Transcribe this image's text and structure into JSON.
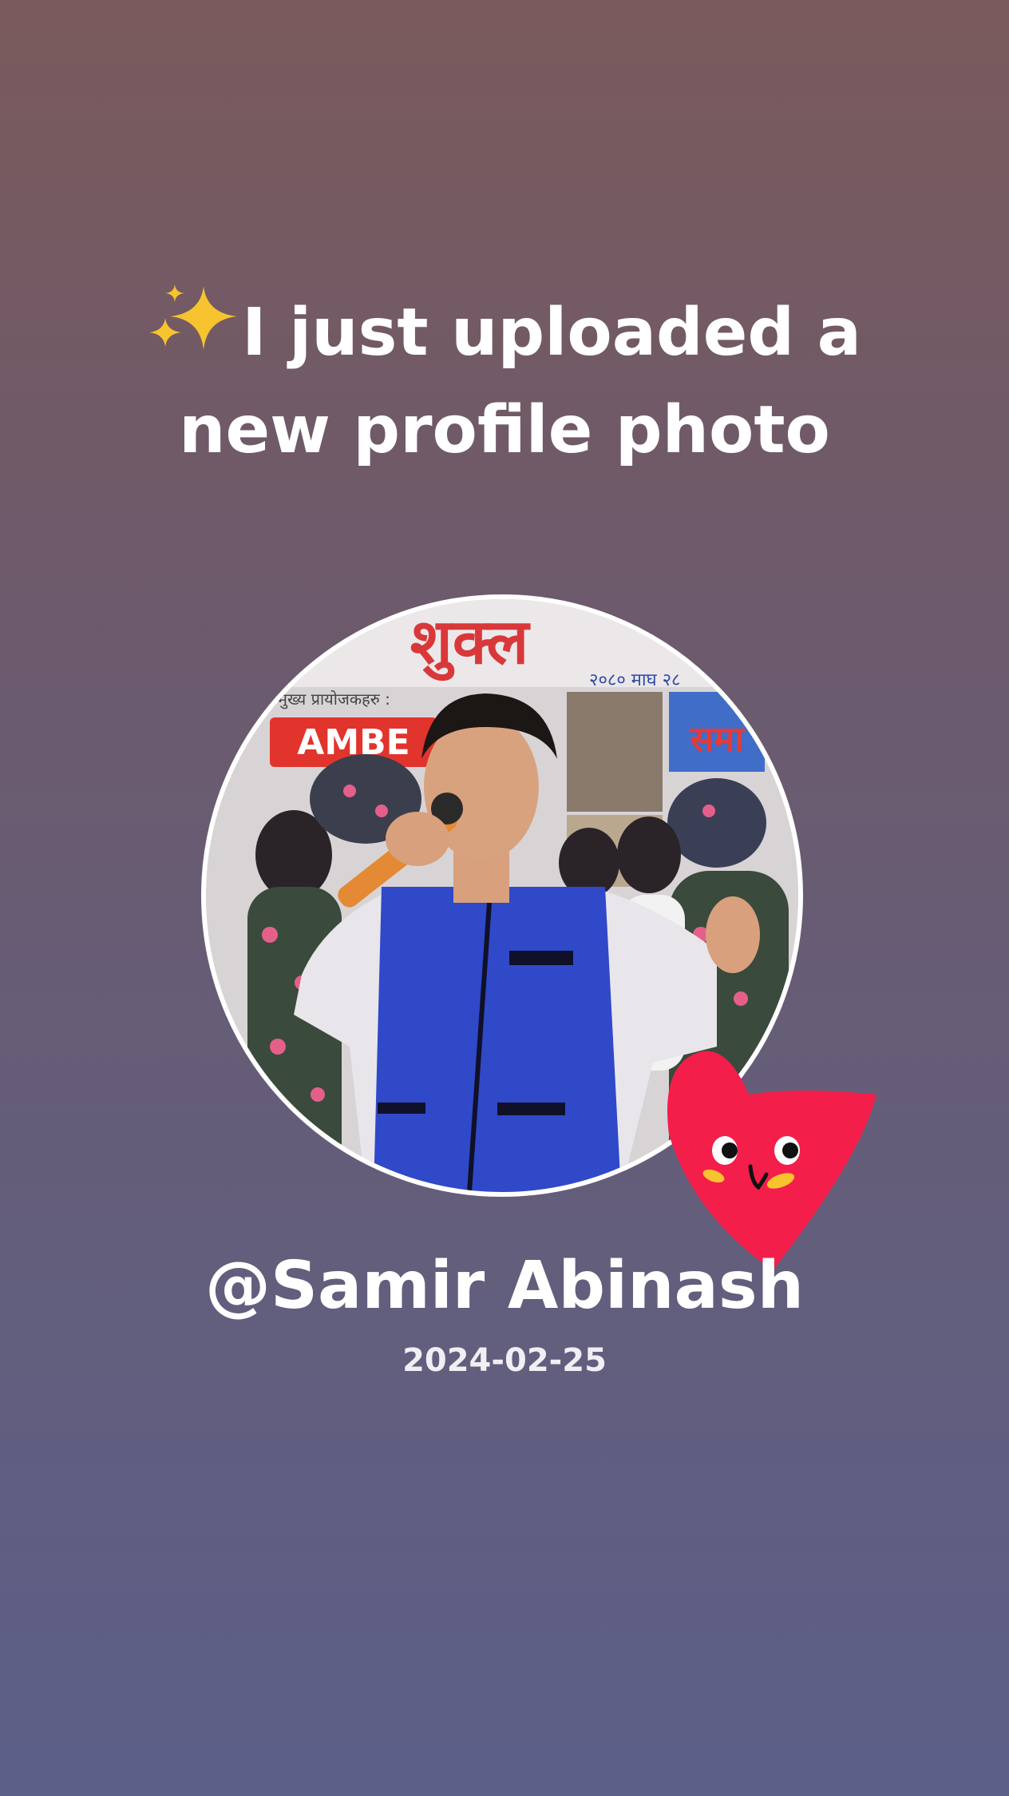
{
  "post": {
    "headline_line1": "I just uploaded a",
    "headline_line2": "new profile photo",
    "headline_icon": "sparkles-icon",
    "username": "@Samir Abinash",
    "date": "2024-02-25"
  },
  "photo": {
    "description_icon": "profile-photo",
    "banner_text": "शुक्ल",
    "banner_subtext": "२०८० माघ २८",
    "sponsor_label": "मुख्य प्रायोजकहरु :",
    "sponsor_brand": "AMBE",
    "side_sign": "समा"
  },
  "sticker": {
    "icon": "smiling-heart-sticker-icon"
  },
  "colors": {
    "background_top": "#7a5a5c",
    "background_bottom": "#5c5f88",
    "text": "#ffffff",
    "heart": "#f41e4b",
    "sparkle": "#f7c32e",
    "vest": "#2f49c8"
  }
}
